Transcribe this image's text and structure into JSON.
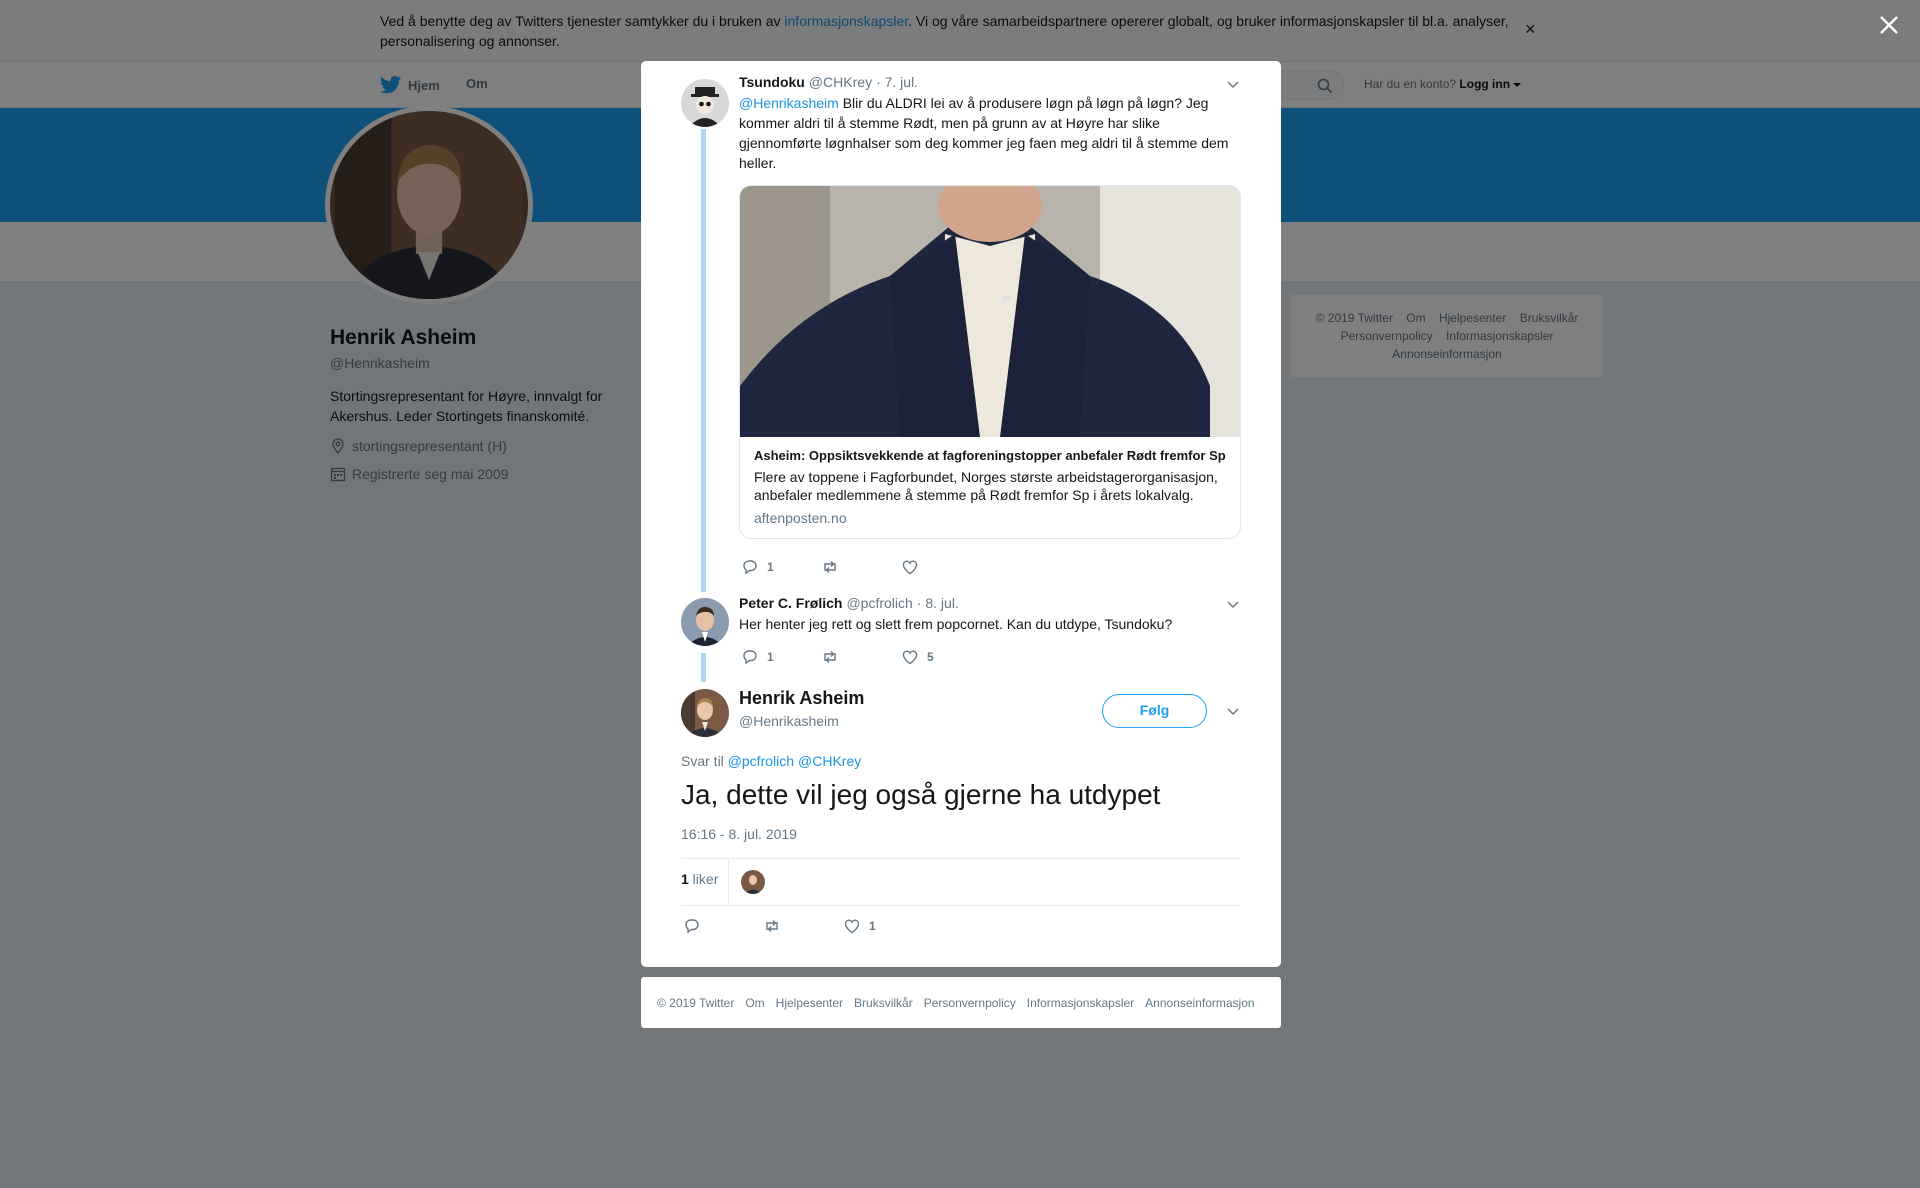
{
  "cookie_bar": {
    "text_before": "Ved å benytte deg av Twitters tjenester samtykker du i bruken av ",
    "link": "informasjonskapsler",
    "text_after": ". Vi og våre samarbeidspartnere opererer globalt, og bruker informasjonskapsler til bl.a. analyser, personalisering og annonser.",
    "close": "×"
  },
  "nav": {
    "home": "Hjem",
    "about": "Om",
    "login_question": "Har du en konto?",
    "login_link": "Logg inn"
  },
  "profile": {
    "name": "Henrik Asheim",
    "handle": "@Henrikasheim",
    "bio": "Stortingsrepresentant for Høyre, innvalgt for Akershus. Leder Stortingets finanskomité.",
    "location": "stortingsrepresentant (H)",
    "joined": "Registrerte seg mai 2009"
  },
  "side_footer": {
    "links": [
      "© 2019 Twitter",
      "Om",
      "Hjelpesenter",
      "Bruksvilkår",
      "Personvernpolicy",
      "Informasjonskapsler",
      "Annonseinformasjon"
    ]
  },
  "tweet1": {
    "name": "Tsundoku",
    "handle": "@CHKrey",
    "date": "· 7. jul.",
    "mention": "@Henrikasheim",
    "text": " Blir du ALDRI lei av å produsere løgn på løgn på løgn? Jeg kommer aldri til å stemme Rødt, men på grunn av at Høyre har slike gjennomførte løgnhalser som deg kommer jeg faen meg aldri til å stemme dem heller.",
    "card": {
      "title": "Asheim: Oppsiktsvekkende at fagforeningstopper anbefaler Rødt fremfor Sp",
      "description": "Flere av toppene i Fagforbundet, Norges største arbeidstagerorganisasjon, anbefaler medlemmene å stemme på Rødt fremfor Sp i årets lokalvalg.",
      "domain": "aftenposten.no"
    },
    "replies": "1",
    "retweets": "",
    "likes": ""
  },
  "tweet2": {
    "name": "Peter C. Frølich",
    "handle": "@pcfrolich",
    "date": "· 8. jul.",
    "text": "Her henter jeg rett og slett frem popcornet. Kan du utdype, Tsundoku?",
    "replies": "1",
    "retweets": "",
    "likes": "5"
  },
  "main_tweet": {
    "name": "Henrik Asheim",
    "handle": "@Henrikasheim",
    "follow": "Følg",
    "reply_prefix": "Svar til ",
    "reply_handles": [
      "@pcfrolich",
      "@CHKrey"
    ],
    "text": "Ja, dette vil jeg også gjerne ha utdypet",
    "timestamp": "16:16 - 8. jul. 2019",
    "likes_count": "1",
    "likes_label": " liker",
    "action_likes": "1"
  },
  "modal_footer": {
    "links": [
      "© 2019 Twitter",
      "Om",
      "Hjelpesenter",
      "Bruksvilkår",
      "Personvernpolicy",
      "Informasjonskapsler",
      "Annonseinformasjon"
    ]
  },
  "colors": {
    "accent": "#1da1f2",
    "link": "#1b95e0",
    "thread_line": "#aad8f5",
    "overlay": "rgba(0,0,0,0.5)"
  }
}
